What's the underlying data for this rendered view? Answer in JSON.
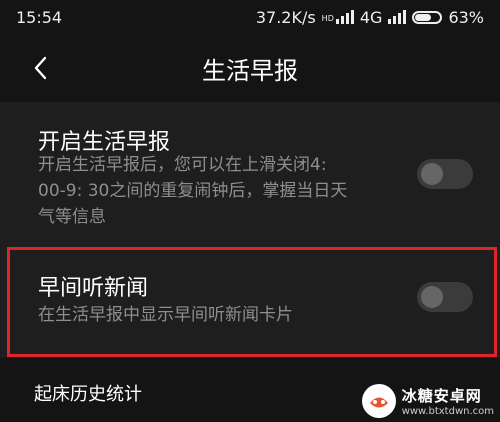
{
  "status_bar": {
    "time": "15:54",
    "network_speed": "37.2K/s",
    "network_type": "4G",
    "hd_badge": "HD",
    "battery_percent": "63%",
    "battery_level": 0.63
  },
  "header": {
    "back_icon": "chevron-left-icon",
    "title": "生活早报"
  },
  "settings": {
    "daily_brief": {
      "title": "开启生活早报",
      "desc_lines": [
        "开启生活早报后，您可以在上滑关闭4:",
        "00-9: 30之间的重复闹钟后，掌握当日天",
        "气等信息"
      ],
      "enabled": false
    },
    "morning_news": {
      "title": "早间听新闻",
      "desc": "在生活早报中显示早间听新闻卡片",
      "enabled": false
    },
    "wake_history": {
      "title": "起床历史统计"
    }
  },
  "colors": {
    "highlight": "#e0242a",
    "background": "#141414",
    "card": "#1e1e1e"
  },
  "watermark": {
    "name": "冰糖安卓网",
    "url": "www.btxtdwn.com"
  }
}
